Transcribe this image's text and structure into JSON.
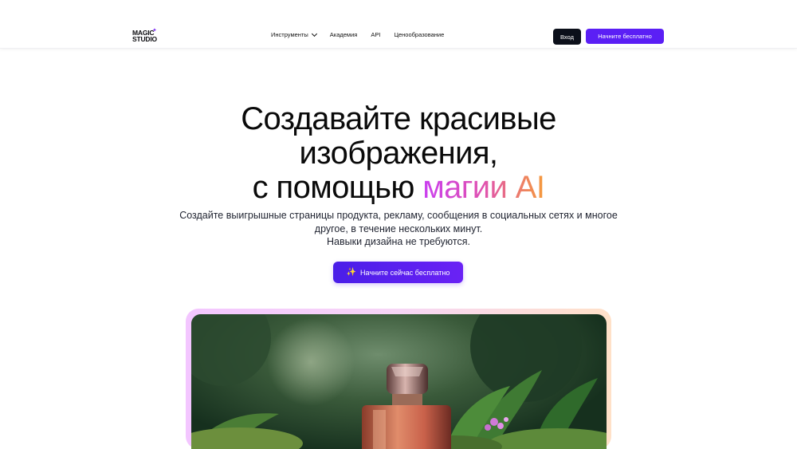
{
  "header": {
    "logo_line1": "MAGIC",
    "logo_line2": "STUDIO",
    "nav": [
      {
        "label": "Инструменты",
        "has_dropdown": true
      },
      {
        "label": "Академия"
      },
      {
        "label": "API"
      },
      {
        "label": "Ценообразование"
      }
    ],
    "login_label": "Вход",
    "start_label": "Начните бесплатно"
  },
  "hero": {
    "title_line1": "Создавайте красивые",
    "title_line2": "изображения,",
    "title_line3_prefix": "с помощью ",
    "title_line3_highlight": "магии AI",
    "subtitle_line1": "Создайте выигрышные страницы продукта, рекламу, сообщения в социальных сетях и многое",
    "subtitle_line2": "другое, в течение нескольких минут.",
    "subtitle_line3": "Навыки дизайна не требуются.",
    "cta_label": "Начните сейчас бесплатно",
    "cta_icon": "sparkle-icon"
  },
  "colors": {
    "accent": "#5b1ff5",
    "dark_button": "#0b0f1a",
    "gradient_start": "#c93ff0",
    "gradient_end": "#f59a3b"
  }
}
